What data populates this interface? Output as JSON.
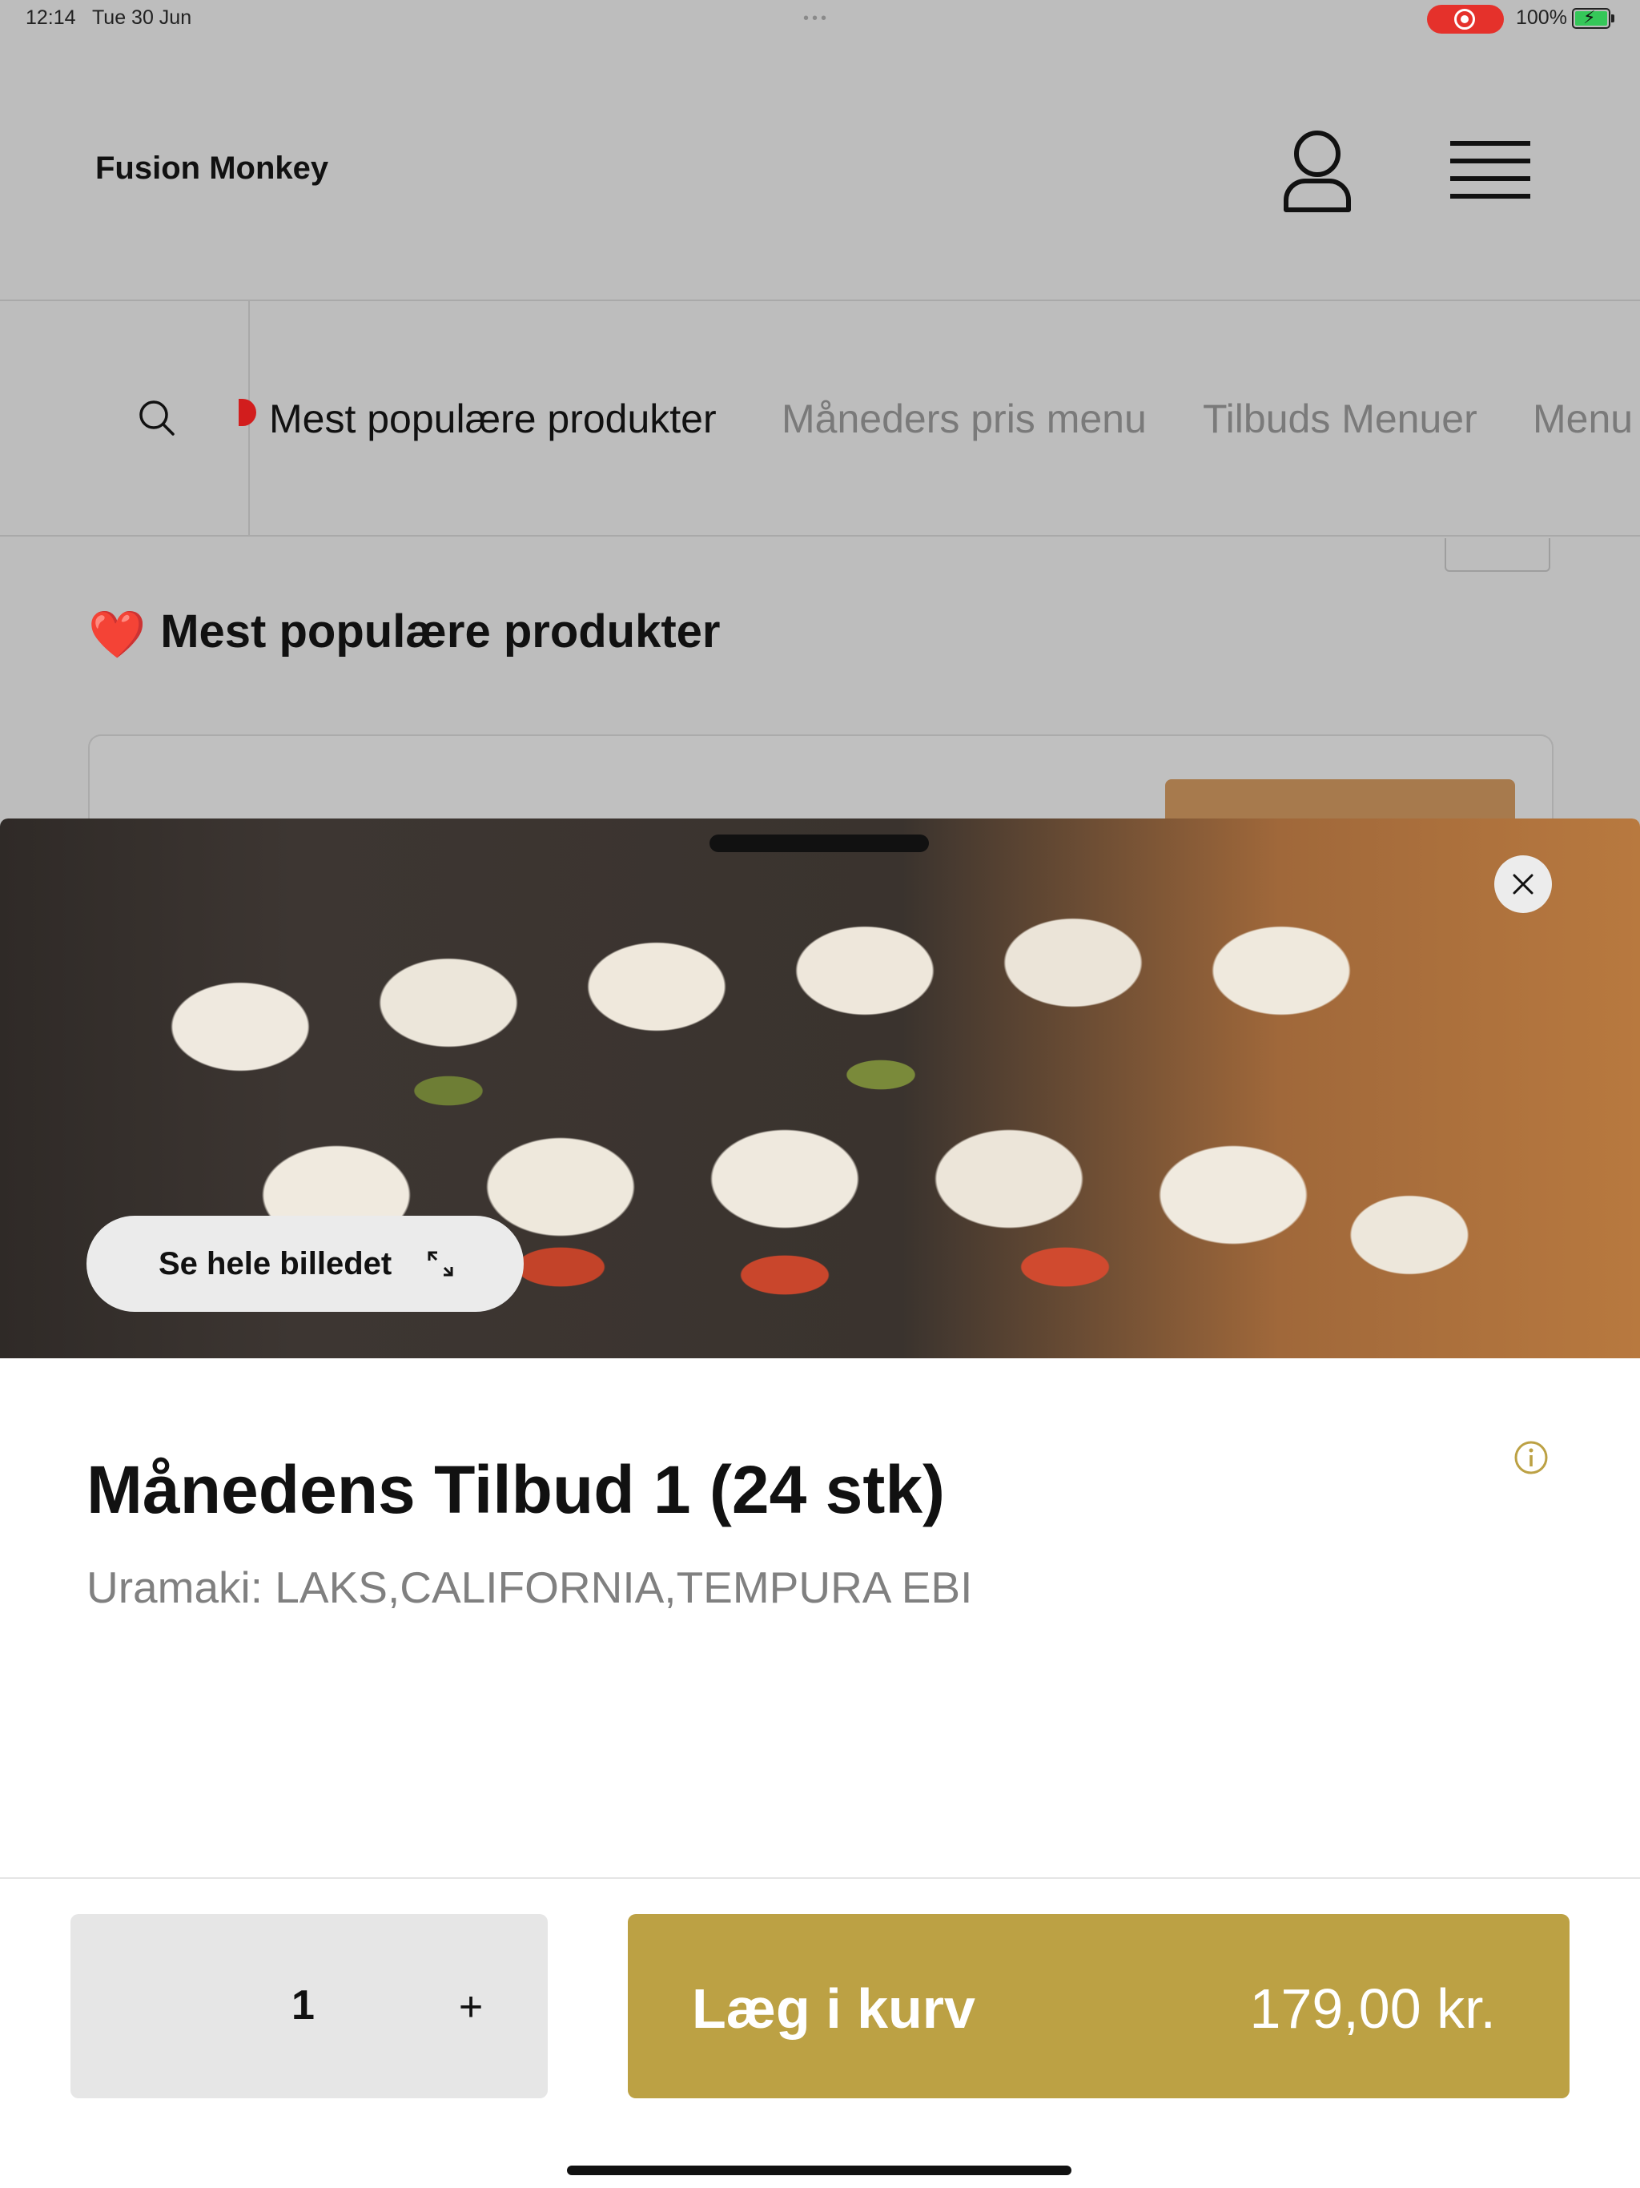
{
  "status_bar": {
    "time": "12:14",
    "date": "Tue 30 Jun",
    "battery": "100%"
  },
  "header": {
    "brand": "Fusion Monkey",
    "profile_icon": "user-icon",
    "menu_icon": "hamburger-menu-icon"
  },
  "nav": {
    "search_icon": "search-icon",
    "tabs": [
      {
        "label": "Mest populære produkter",
        "active": true
      },
      {
        "label": "Måneders pris menu",
        "active": false
      },
      {
        "label": "Tilbuds Menuer",
        "active": false
      },
      {
        "label": "Menu",
        "active": false
      }
    ]
  },
  "page": {
    "section_title": "Mest populære produkter",
    "section_emoji": "❤️"
  },
  "modal": {
    "view_image_label": "Se hele billedet",
    "product_title": "Månedens Tilbud 1 (24 stk)",
    "product_description": "Uramaki: LAKS,CALIFORNIA,TEMPURA EBI",
    "quantity": "1",
    "plus_label": "+",
    "add_to_cart_label": "Læg i kurv",
    "price": "179,00 kr."
  },
  "colors": {
    "accent": "#bca144",
    "record_indicator": "#e5312b",
    "overlay_gray": "#bdbdbd"
  }
}
